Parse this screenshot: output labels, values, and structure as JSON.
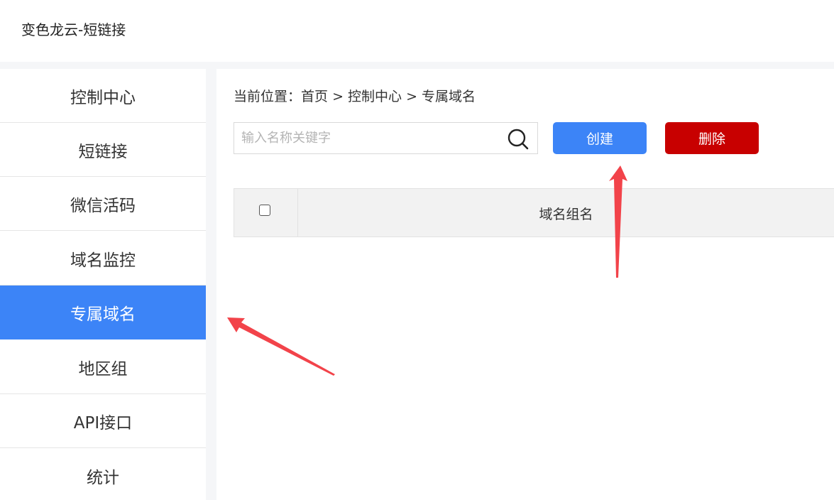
{
  "app": {
    "title": "变色龙云-短链接"
  },
  "sidebar": {
    "items": [
      {
        "label": "控制中心",
        "active": false
      },
      {
        "label": "短链接",
        "active": false
      },
      {
        "label": "微信活码",
        "active": false
      },
      {
        "label": "域名监控",
        "active": false
      },
      {
        "label": "专属域名",
        "active": true
      },
      {
        "label": "地区组",
        "active": false
      },
      {
        "label": "API接口",
        "active": false
      },
      {
        "label": "统计",
        "active": false
      }
    ]
  },
  "breadcrumb": {
    "prefix": "当前位置：",
    "items": [
      "首页",
      "控制中心",
      "专属域名"
    ],
    "separator": " > "
  },
  "search": {
    "placeholder": "输入名称关键字",
    "value": "",
    "icon": "search-icon"
  },
  "toolbar": {
    "create_label": "创建",
    "delete_label": "删除"
  },
  "table": {
    "columns": [
      "域名组名"
    ],
    "rows": []
  },
  "colors": {
    "primary": "#3c84f7",
    "danger": "#c80000",
    "annotation_arrow": "#f2434a"
  }
}
